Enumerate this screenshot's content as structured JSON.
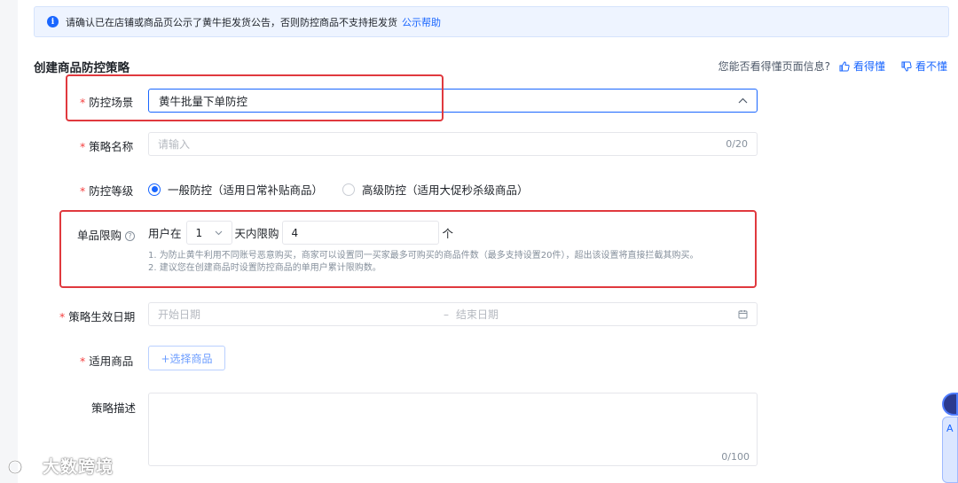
{
  "notice": {
    "text": "请确认已在店铺或商品页公示了黄牛拒发货公告，否则防控商品不支持拒发货",
    "link": "公示帮助"
  },
  "page": {
    "title": "创建商品防控策略"
  },
  "feedback": {
    "question": "您能否看得懂页面信息?",
    "yes": "看得懂",
    "no": "看不懂"
  },
  "form": {
    "scene": {
      "label": "防控场景",
      "value": "黄牛批量下单防控"
    },
    "name": {
      "label": "策略名称",
      "placeholder": "请输入",
      "counter": "0/20"
    },
    "level": {
      "label": "防控等级",
      "options": [
        "一般防控（适用日常补贴商品）",
        "高级防控（适用大促秒杀级商品）"
      ],
      "selected": 0
    },
    "limit": {
      "label": "单品限购",
      "user_text": "用户在",
      "days": "1",
      "days_text": "天内限购",
      "qty": "4",
      "unit": "个",
      "hints": [
        "1. 为防止黄牛利用不同账号恶意购买，商家可以设置同一买家最多可购买的商品件数（最多支持设置20件），超出该设置将直接拦截其购买。",
        "2. 建议您在创建商品时设置防控商品的单用户累计限购数。"
      ]
    },
    "date": {
      "label": "策略生效日期",
      "start_placeholder": "开始日期",
      "sep": "–",
      "end_placeholder": "结束日期"
    },
    "goods": {
      "label": "适用商品",
      "button": "+选择商品"
    },
    "desc": {
      "label": "策略描述",
      "counter": "0/100"
    }
  },
  "watermark": {
    "text": "大数跨境"
  },
  "side_widget": {
    "letter": "A"
  },
  "colors": {
    "primary": "#1966ff",
    "required": "#f53f3f",
    "highlight": "#e0393e"
  }
}
